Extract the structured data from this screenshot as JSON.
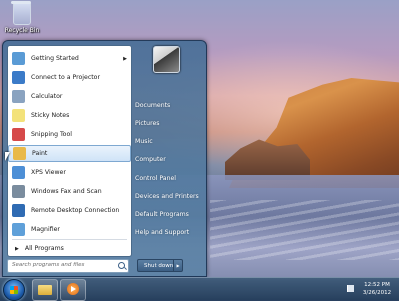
{
  "desktop": {
    "recycle_bin_label": "Recycle Bin"
  },
  "start_menu": {
    "programs": [
      {
        "label": "Getting Started",
        "icon": "getting-started-icon",
        "color": "#5a9bd5",
        "has_submenu": true
      },
      {
        "label": "Connect to a Projector",
        "icon": "projector-icon",
        "color": "#3b7bc8",
        "has_submenu": false
      },
      {
        "label": "Calculator",
        "icon": "calculator-icon",
        "color": "#8aa3c0",
        "has_submenu": false
      },
      {
        "label": "Sticky Notes",
        "icon": "sticky-notes-icon",
        "color": "#f3e27a",
        "has_submenu": false
      },
      {
        "label": "Snipping Tool",
        "icon": "scissors-icon",
        "color": "#d64a4a",
        "has_submenu": false
      },
      {
        "label": "Paint",
        "icon": "paint-icon",
        "color": "#e9b949",
        "has_submenu": false,
        "selected": true
      },
      {
        "label": "XPS Viewer",
        "icon": "xps-viewer-icon",
        "color": "#4d8fd6",
        "has_submenu": false
      },
      {
        "label": "Windows Fax and Scan",
        "icon": "fax-scan-icon",
        "color": "#7a8c9e",
        "has_submenu": false
      },
      {
        "label": "Remote Desktop Connection",
        "icon": "remote-desktop-icon",
        "color": "#2f6bb3",
        "has_submenu": false
      },
      {
        "label": "Magnifier",
        "icon": "magnifier-icon",
        "color": "#5fa0d9",
        "has_submenu": false
      }
    ],
    "all_programs_label": "All Programs",
    "search_placeholder": "Search programs and files",
    "right_items": [
      "Documents",
      "Pictures",
      "Music",
      "Computer",
      "Control Panel",
      "Devices and Printers",
      "Default Programs",
      "Help and Support"
    ],
    "shutdown_label": "Shut down"
  },
  "taskbar": {
    "time": "12:52 PM",
    "date": "3/26/2012"
  }
}
